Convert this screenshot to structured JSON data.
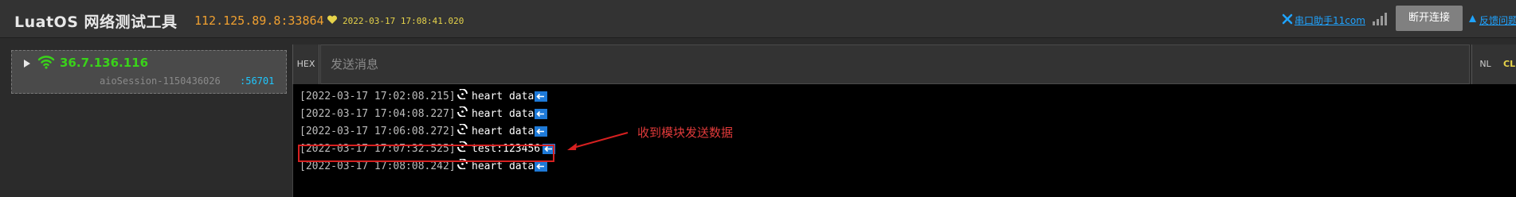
{
  "header": {
    "app_title": "LuatOS 网络测试工具",
    "server_address": "112.125.89.8:33864",
    "server_time": "2022-03-17 17:08:41.020",
    "tool_link": "串口助手11com",
    "disconnect_label": "断开连接",
    "feedback_link": "反馈问题"
  },
  "sidebar": {
    "clients": [
      {
        "ip": "36.7.136.116",
        "session": "aioSession-1150436026",
        "port": ":56701"
      }
    ]
  },
  "send_bar": {
    "hex_label": "HEX",
    "placeholder": "发送消息",
    "nl_label": "NL",
    "clr_label": "CLR"
  },
  "log": [
    {
      "time": "[2022-03-17 17:02:08.215]",
      "message": "heart data"
    },
    {
      "time": "[2022-03-17 17:04:08.227]",
      "message": "heart data"
    },
    {
      "time": "[2022-03-17 17:06:08.272]",
      "message": "heart data"
    },
    {
      "time": "[2022-03-17 17:07:32.525]",
      "message": "test:123456"
    },
    {
      "time": "[2022-03-17 17:08:08.242]",
      "message": "heart data"
    }
  ],
  "annotation": "收到模块发送数据",
  "icons": {
    "heart": "heart-icon",
    "tool": "tool-icon",
    "signal": "signal-icon",
    "feedback": "feedback-icon",
    "wifi": "wifi-icon",
    "caret": "caret-right-icon",
    "direction": "receive-icon",
    "newline": "newline-icon"
  },
  "colors": {
    "accent_orange": "#f0a030",
    "client_green": "#3ad21a",
    "link_blue": "#1fa3ff",
    "annotation_red": "#e03a3a"
  }
}
